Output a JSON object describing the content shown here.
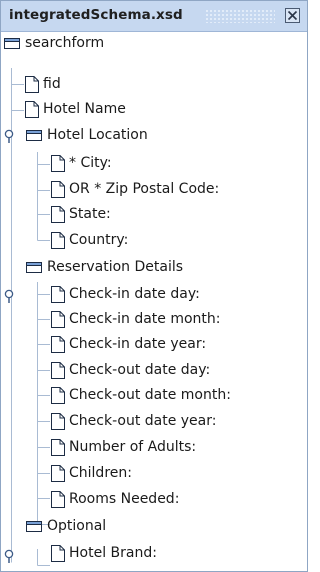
{
  "window": {
    "title": "integratedSchema.xsd"
  },
  "tree": {
    "root": "searchform",
    "items": [
      {
        "label": "fid"
      },
      {
        "label": "Hotel Name"
      },
      {
        "label": "Hotel Location"
      },
      {
        "label": "* City:"
      },
      {
        "label": "OR * Zip Postal Code:"
      },
      {
        "label": "State:"
      },
      {
        "label": "Country:"
      },
      {
        "label": "Reservation Details"
      },
      {
        "label": "Check-in date day:"
      },
      {
        "label": "Check-in date month:"
      },
      {
        "label": "Check-in date year:"
      },
      {
        "label": "Check-out date day:"
      },
      {
        "label": "Check-out date month:"
      },
      {
        "label": "Check-out date year:"
      },
      {
        "label": "Number of Adults:"
      },
      {
        "label": "Children:"
      },
      {
        "label": "Rooms Needed:"
      },
      {
        "label": "Optional"
      },
      {
        "label": "Hotel Brand:"
      }
    ]
  },
  "icons": {
    "folder": "folder-icon",
    "file": "file-icon",
    "expand_handle": "expanded-handle-icon",
    "close": "close-icon"
  },
  "colors": {
    "titlebar": "#c6d8f0",
    "guide_lines": "#a9bbd3",
    "folder_tab": "#7aa1d6"
  }
}
